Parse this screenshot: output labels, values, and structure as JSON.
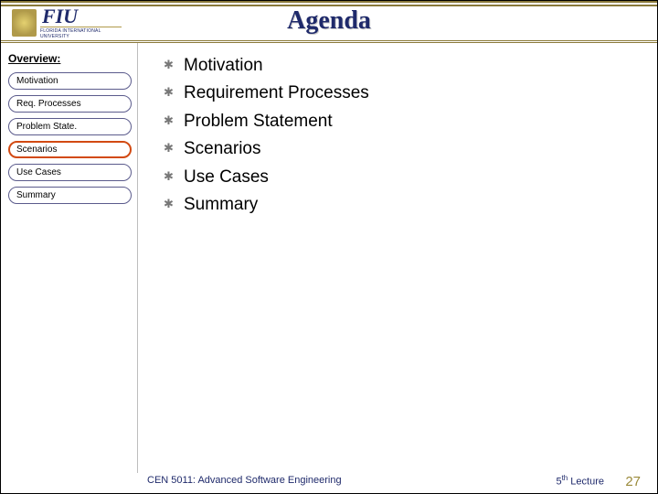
{
  "header": {
    "title": "Agenda",
    "logo": {
      "initials": "FIU",
      "subtext": "FLORIDA INTERNATIONAL UNIVERSITY"
    }
  },
  "sidebar": {
    "heading": "Overview:",
    "items": [
      {
        "label": "Motivation",
        "active": false
      },
      {
        "label": "Req. Processes",
        "active": false
      },
      {
        "label": "Problem State.",
        "active": false
      },
      {
        "label": "Scenarios",
        "active": true
      },
      {
        "label": "Use Cases",
        "active": false
      },
      {
        "label": "Summary",
        "active": false
      }
    ]
  },
  "content": {
    "bullets": [
      "Motivation",
      "Requirement Processes",
      "Problem Statement",
      "Scenarios",
      "Use Cases",
      "Summary"
    ]
  },
  "footer": {
    "left": "CEN 5011: Advanced Software Engineering",
    "right_prefix": "5",
    "right_ordinal": "th",
    "right_suffix": " Lecture",
    "page": "27"
  }
}
